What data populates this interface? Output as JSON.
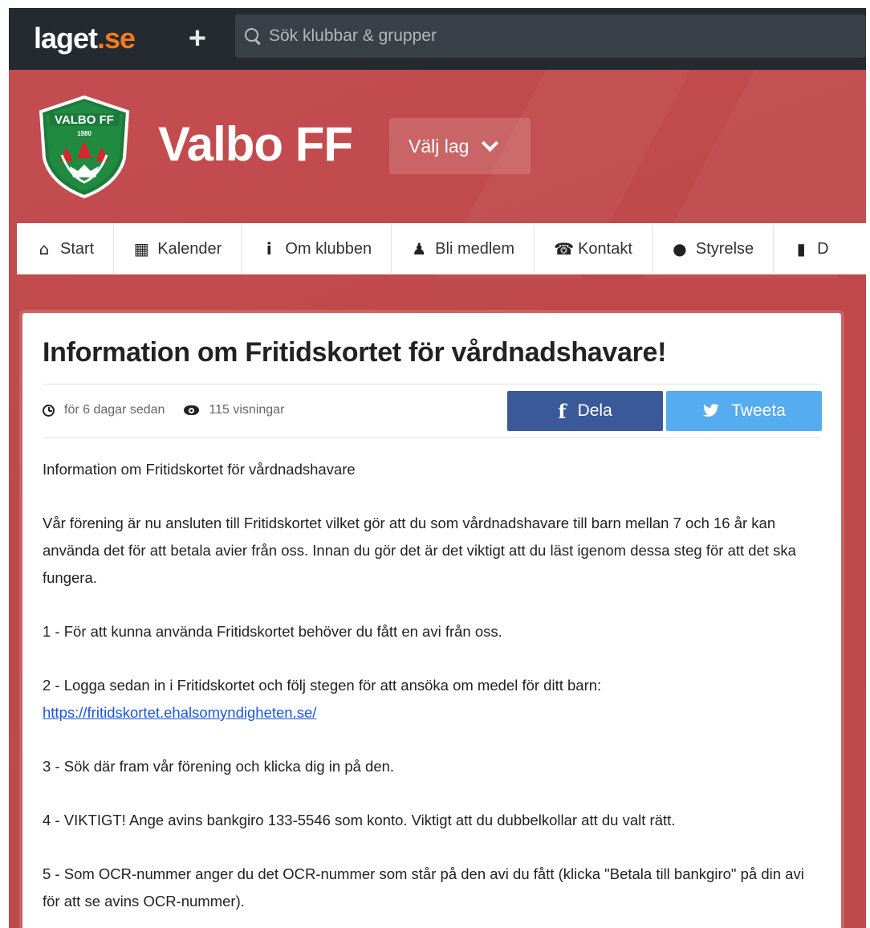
{
  "topbar": {
    "logo_main": "laget",
    "logo_tld": ".se",
    "search_placeholder": "Sök klubbar & grupper"
  },
  "header": {
    "crest_top": "VALBO FF",
    "crest_year": "1980",
    "club_name": "Valbo FF",
    "team_select": "Välj lag"
  },
  "nav": {
    "items": [
      {
        "label": "Start",
        "icon": "home-icon"
      },
      {
        "label": "Kalender",
        "icon": "calendar-icon"
      },
      {
        "label": "Om klubben",
        "icon": "info-icon"
      },
      {
        "label": "Bli medlem",
        "icon": "person-icon"
      },
      {
        "label": "Kontakt",
        "icon": "phone-icon"
      },
      {
        "label": "Styrelse",
        "icon": "user-icon"
      },
      {
        "label": "D",
        "icon": "document-icon"
      }
    ]
  },
  "article": {
    "title": "Information om Fritidskortet för vårdnadshavare!",
    "posted": "för 6 dagar sedan",
    "views": "115 visningar",
    "share_facebook": "Dela",
    "share_twitter": "Tweeta",
    "paragraphs": [
      "Information om Fritidskortet för vårdnadshavare",
      "Vår förening är nu ansluten till Fritidskortet vilket gör att du som vårdnadshavare till barn mellan 7 och 16 år kan använda det för att betala avier från oss. Innan du gör det är det viktigt att du läst igenom dessa steg för att det ska fungera.",
      "1 - För att kunna använda Fritidskortet behöver du fått en avi från oss.",
      "2 - Logga sedan in i Fritidskortet och följ stegen för att ansöka om medel för ditt barn:",
      "3 - Sök där fram vår förening och klicka dig in på den.",
      "4 - VIKTIGT! Ange avins bankgiro 133-5546 som konto. Viktigt att du dubbelkollar att du valt rätt.",
      "5 - Som OCR-nummer anger du det OCR-nummer som står på den avi du fått (klicka \"Betala till bankgiro\" på din avi för att se avins OCR-nummer)."
    ],
    "link": "https://fritidskortet.ehalsomyndigheten.se/"
  },
  "colors": {
    "topbar": "#242a2f",
    "brand_orange": "#f47a20",
    "club_red": "#c04a4c",
    "facebook": "#3b5998",
    "twitter": "#55acee",
    "link": "#1a56db"
  }
}
